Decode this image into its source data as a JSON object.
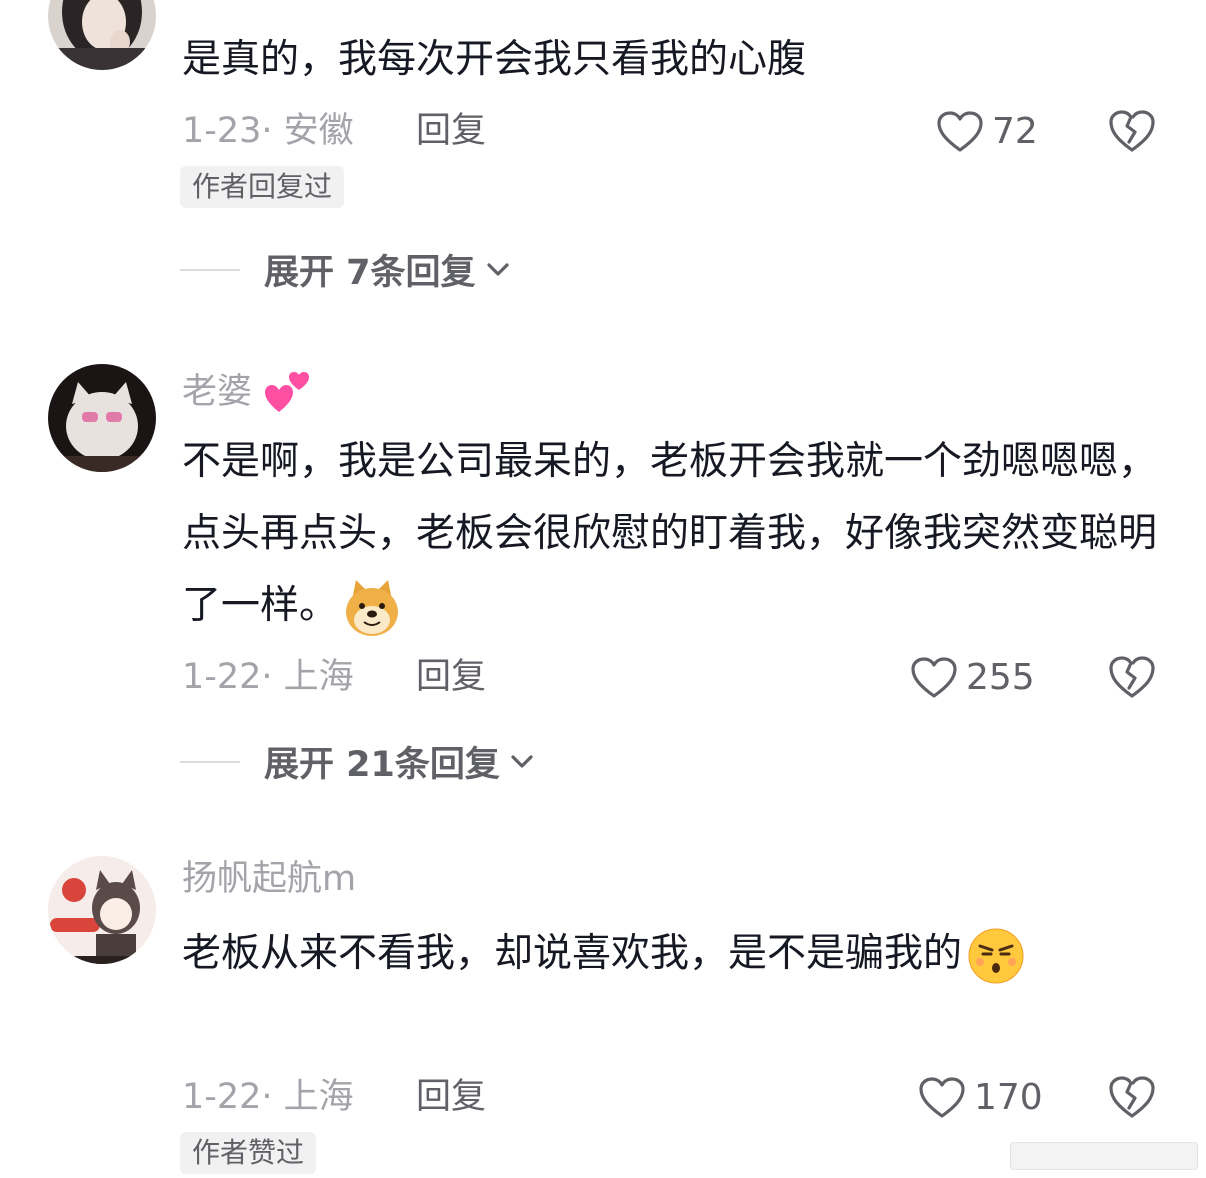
{
  "comments": [
    {
      "username": "",
      "text": "是真的，我每次开会我只看我的心腹",
      "date_location": "1-23· 安徽",
      "reply_label": "回复",
      "likes": "72",
      "badge": "作者回复过",
      "expand_label": "展开 7条回复",
      "avatar_icon": "user-avatar-woman-photo"
    },
    {
      "username": "老婆",
      "username_emoji": "two-hearts-emoji",
      "text": "不是啊，我是公司最呆的，老板开会我就一个劲嗯嗯嗯，点头再点头，老板会很欣慰的盯着我，好像我突然变聪明了一样。",
      "text_emoji": "doge-emoji",
      "date_location": "1-22· 上海",
      "reply_label": "回复",
      "likes": "255",
      "expand_label": "展开 21条回复",
      "avatar_icon": "user-avatar-white-cat"
    },
    {
      "username": "扬帆起航m",
      "text": "老板从来不看我，却说喜欢我，是不是骗我的",
      "text_emoji": "pouting-face-emoji",
      "date_location": "1-22· 上海",
      "reply_label": "回复",
      "likes": "170",
      "badge": "作者赞过",
      "avatar_icon": "user-avatar-cartoon-girl"
    }
  ],
  "colors": {
    "text": "#161823",
    "secondary": "#a3a4a9",
    "action": "#606166",
    "badge_bg": "#f1f1f2"
  }
}
